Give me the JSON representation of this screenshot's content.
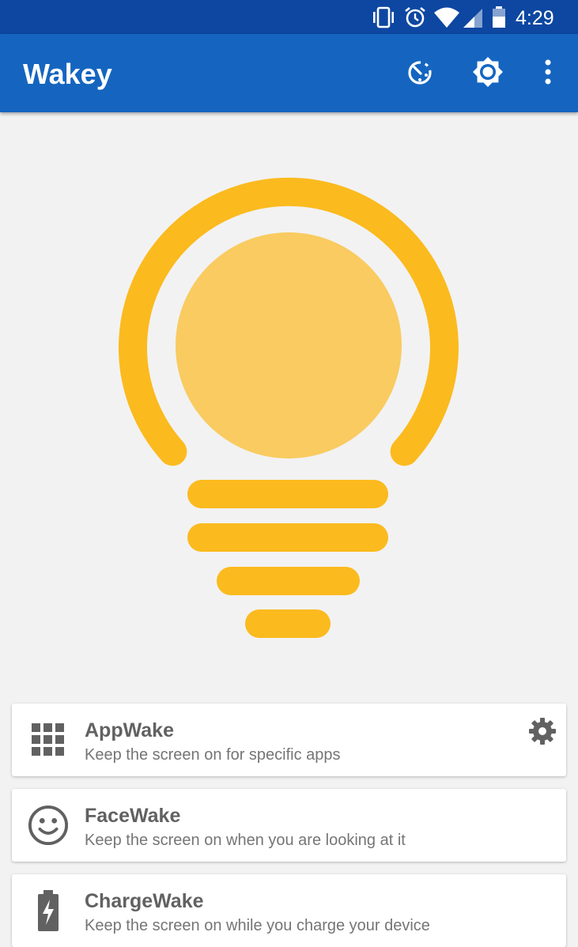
{
  "status_bar": {
    "time": "4:29",
    "icons": [
      "vibrate-icon",
      "alarm-icon",
      "wifi-icon",
      "cell-signal-icon",
      "battery-icon"
    ]
  },
  "app_bar": {
    "title": "Wakey",
    "actions": [
      "timer-icon",
      "brightness-icon",
      "more-vert-icon"
    ]
  },
  "colors": {
    "status_bar": "#0d47a1",
    "app_bar": "#1565c0",
    "bulb_ring": "#fbba1e",
    "bulb_glow": "#f9cb60",
    "background": "#f2f2f2",
    "icon_gray": "#616161"
  },
  "modes": [
    {
      "title": "AppWake",
      "subtitle": "Keep the screen on for specific apps",
      "icon": "grid-apps-icon",
      "has_settings": true
    },
    {
      "title": "FaceWake",
      "subtitle": "Keep the screen on when you are looking at it",
      "icon": "smiley-face-icon",
      "has_settings": false
    },
    {
      "title": "ChargeWake",
      "subtitle": "Keep the screen on while you charge your device",
      "icon": "battery-charging-icon",
      "has_settings": false
    }
  ]
}
